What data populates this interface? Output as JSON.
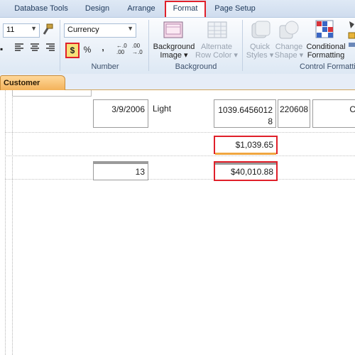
{
  "ribbon_tabs": [
    "Database Tools",
    "Design",
    "Arrange",
    "Format",
    "Page Setup"
  ],
  "font_size": "11",
  "format_combo": "Currency",
  "number_group": {
    "label": "Number",
    "dollar": "$",
    "percent": "%",
    "comma": ",",
    "increase_decimals": "←.0\n.00",
    "decrease_decimals": ".00\n→.0"
  },
  "background_group": {
    "label": "Background",
    "background_image": "Background\nImage ▾",
    "alternate_row_color": "Alternate\nRow Color ▾"
  },
  "control_group": {
    "label": "Control Formatti",
    "quick_styles": "Quick\nStyles ▾",
    "change_shape": "Change\nShape ▾",
    "conditional_formatting": "Conditional\nFormatting"
  },
  "document_tab": "Customer Orders",
  "report": {
    "date": "3/9/2006",
    "shipping": "Light",
    "amount_raw": "1039.6456012\n8",
    "code": "220608",
    "partial": "C",
    "sum_formatted": "$1,039.65",
    "count": "13",
    "total_formatted": "$40,010.88"
  }
}
